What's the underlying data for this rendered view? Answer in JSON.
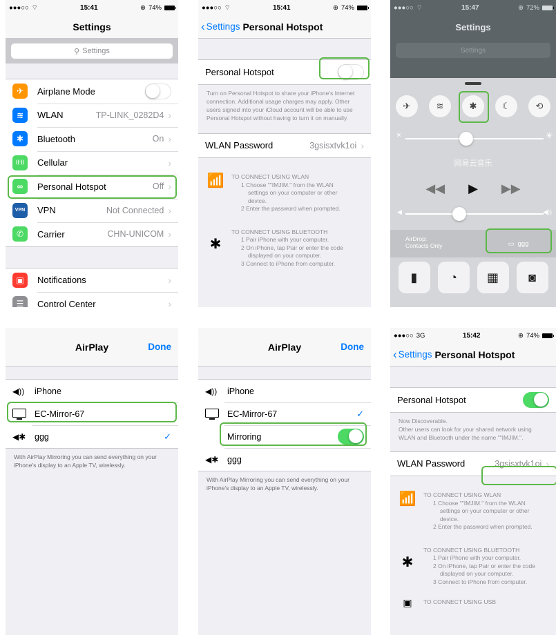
{
  "status": {
    "carrier_dots": "●●●○○",
    "wifi": "wifi-icon",
    "time_1": "15:41",
    "time_2": "15:41",
    "time_3": "15:47",
    "time_6": "15:42",
    "network_6": "3G",
    "battery_1": "74%",
    "battery_3": "72%",
    "battery_6": "74%"
  },
  "settings": {
    "title": "Settings",
    "search_placeholder": "Settings",
    "rows_a": [
      {
        "label": "Airplane Mode",
        "value": "",
        "icon": "airplane-icon",
        "color": "#ff9500"
      },
      {
        "label": "WLAN",
        "value": "TP-LINK_0282D4",
        "icon": "wifi-icon",
        "color": "#007aff"
      },
      {
        "label": "Bluetooth",
        "value": "On",
        "icon": "bluetooth-icon",
        "color": "#007aff"
      },
      {
        "label": "Cellular",
        "value": "",
        "icon": "cellular-icon",
        "color": "#4cd964"
      },
      {
        "label": "Personal Hotspot",
        "value": "Off",
        "icon": "hotspot-icon",
        "color": "#4cd964"
      },
      {
        "label": "VPN",
        "value": "Not Connected",
        "icon": "vpn-icon",
        "color": "#1e5ea8"
      },
      {
        "label": "Carrier",
        "value": "CHN-UNICOM",
        "icon": "phone-icon",
        "color": "#4cd964"
      }
    ],
    "rows_b": [
      {
        "label": "Notifications",
        "icon": "notifications-icon",
        "color": "#ff3b30"
      },
      {
        "label": "Control Center",
        "icon": "control-center-icon",
        "color": "#8e8e93"
      }
    ]
  },
  "hotspot": {
    "back": "Settings",
    "title": "Personal Hotspot",
    "toggle_label": "Personal Hotspot",
    "note_off": "Turn on Personal Hotspot to share your iPhone's Internet connection. Additional usage charges may apply. Other users signed into your iCloud account will be able to use Personal Hotspot without having to turn it on manually.",
    "note_on_1": "Now Discoverable.",
    "note_on_2": "Other users can look for your shared network using WLAN and Bluetooth under the name \"\"IMJIM.\".",
    "password_label": "WLAN Password",
    "password_value": "3gsisxtvk1oi",
    "wlan_head": "TO CONNECT USING WLAN",
    "wlan_1": "1 Choose \"\"IMJIM.\" from the WLAN",
    "wlan_1b": "settings on your computer or other",
    "wlan_1c": "device.",
    "wlan_2": "2 Enter the password when prompted.",
    "bt_head": "TO CONNECT USING BLUETOOTH",
    "bt_1": "1 Pair iPhone with your computer.",
    "bt_2": "2 On iPhone, tap Pair or enter the code",
    "bt_2b": "displayed on your computer.",
    "bt_3": "3 Connect to iPhone from computer.",
    "usb_head": "TO CONNECT USING USB"
  },
  "control_center": {
    "title": "Settings",
    "search_placeholder": "Settings",
    "music_title": "网易云音乐",
    "airdrop_1": "AirDrop:",
    "airdrop_2": "Contacts Only",
    "airplay_label": "ggg"
  },
  "airplay": {
    "title": "AirPlay",
    "done": "Done",
    "device_1": "iPhone",
    "device_2": "EC-Mirror-67",
    "device_3": "ggg",
    "mirroring": "Mirroring",
    "note": "With AirPlay Mirroring you can send everything on your iPhone's display to an Apple TV, wirelessly."
  },
  "colors": {
    "highlight": "#5cb848",
    "ios_blue": "#007aff",
    "ios_green": "#4cd964"
  }
}
